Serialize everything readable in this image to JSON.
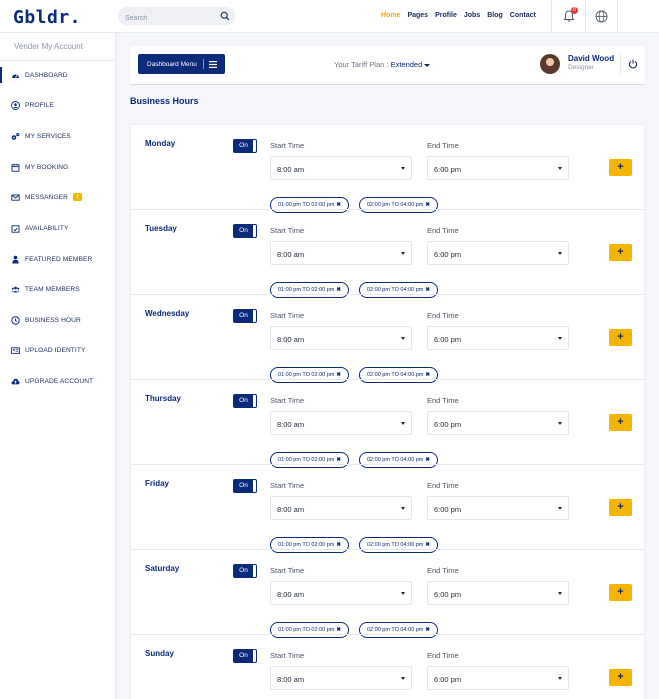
{
  "brand": {
    "logo_text": "Gbldr."
  },
  "search": {
    "placeholder": "Search"
  },
  "nav": {
    "items": [
      "Home",
      "Pages",
      "Profile",
      "Jobs",
      "Blog",
      "Contact"
    ],
    "active_index": 0
  },
  "notifications": {
    "count": "0"
  },
  "sidebar": {
    "heading": "Vender My Account",
    "items": [
      {
        "label": "DASHBOARD",
        "icon": "dashboard-icon"
      },
      {
        "label": "PROFILE",
        "icon": "user-icon"
      },
      {
        "label": "MY SERVICES",
        "icon": "gears-icon"
      },
      {
        "label": "MY BOOKING",
        "icon": "calendar-icon"
      },
      {
        "label": "MESSANGER",
        "icon": "envelope-icon",
        "badge": "1"
      },
      {
        "label": "AVAILABILITY",
        "icon": "calendar-check-icon"
      },
      {
        "label": "FEATURED MEMBER",
        "icon": "user-star-icon"
      },
      {
        "label": "TEAM MEMBERS",
        "icon": "team-icon"
      },
      {
        "label": "BUSINESS HOUR",
        "icon": "clock-icon"
      },
      {
        "label": "UPLOAD IDENTITY",
        "icon": "id-card-icon"
      },
      {
        "label": "UPGRADE ACCOUNT",
        "icon": "cloud-upload-icon"
      }
    ]
  },
  "header": {
    "menu_button": "Dashboard Menu",
    "tariff_label": "Your Tariff Plan :",
    "tariff_value": "Extended",
    "user_name": "David Wood",
    "user_role": "Designer"
  },
  "business_hours": {
    "title": "Business Hours",
    "toggle_label": "On",
    "start_label": "Start Time",
    "end_label": "End Time",
    "add_label": "+",
    "days": [
      {
        "day": "Monday",
        "start": "8:00 am",
        "end": "6:00 pm",
        "slots": [
          "01:00 pm TO 02:00 pm",
          "02:00 pm TO 04:00 pm"
        ]
      },
      {
        "day": "Tuesday",
        "start": "8:00 am",
        "end": "6:00 pm",
        "slots": [
          "01:00 pm TO 02:00 pm",
          "02:00 pm TO 04:00 pm"
        ]
      },
      {
        "day": "Wednesday",
        "start": "8:00 am",
        "end": "6:00 pm",
        "slots": [
          "01:00 pm TO 02:00 pm",
          "02:00 pm TO 04:00 pm"
        ]
      },
      {
        "day": "Thursday",
        "start": "8:00 am",
        "end": "6:00 pm",
        "slots": [
          "01:00 pm TO 02:00 pm",
          "02:00 pm TO 04:00 pm"
        ]
      },
      {
        "day": "Friday",
        "start": "8:00 am",
        "end": "6:00 pm",
        "slots": [
          "01:00 pm TO 02:00 pm",
          "02:00 pm TO 04:00 pm"
        ]
      },
      {
        "day": "Saturday",
        "start": "8:00 am",
        "end": "6:00 pm",
        "slots": [
          "01:00 pm TO 02:00 pm",
          "02:00 pm TO 04:00 pm"
        ]
      },
      {
        "day": "Sunday",
        "start": "8:00 am",
        "end": "6:00 pm",
        "slots": []
      }
    ]
  },
  "colors": {
    "primary": "#0b2a7a",
    "accent": "#f5b400",
    "nav_active": "#f5a400"
  }
}
